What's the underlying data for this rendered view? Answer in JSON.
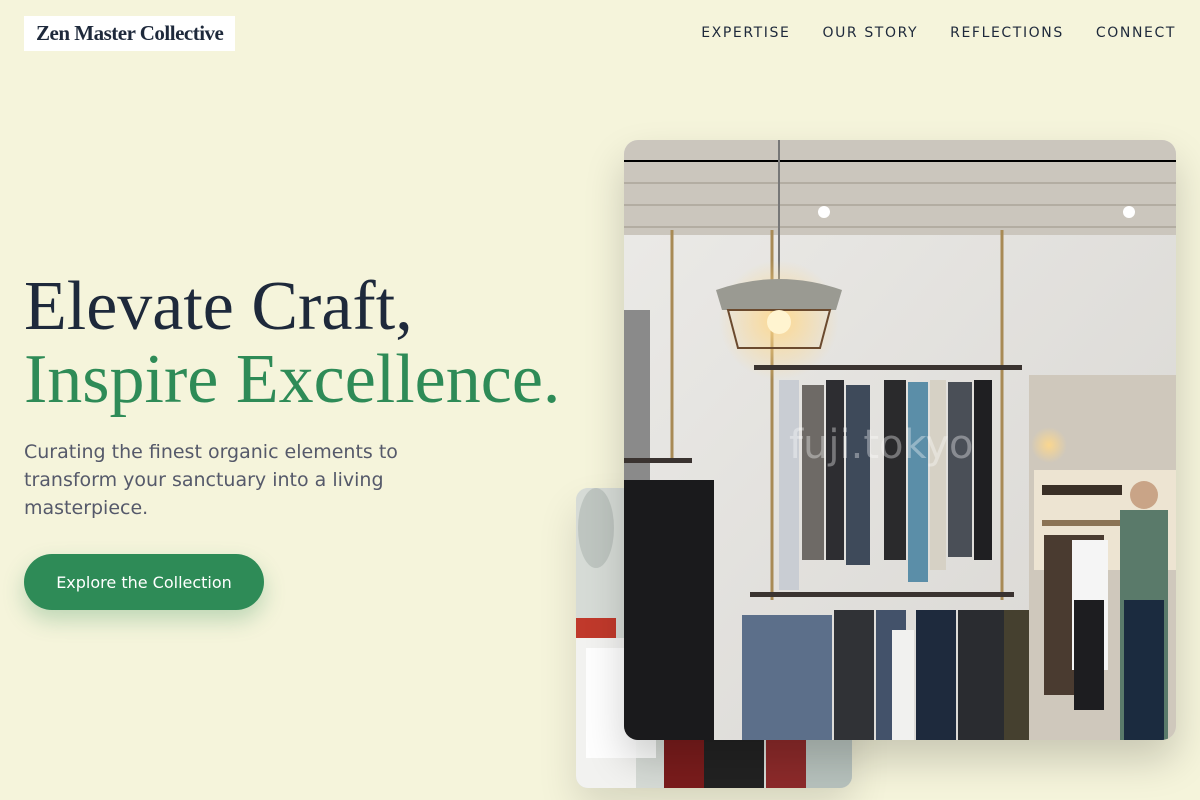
{
  "brand": {
    "logo_text": "Zen Master Collective"
  },
  "nav": {
    "items": [
      {
        "label": "EXPERTISE"
      },
      {
        "label": "OUR STORY"
      },
      {
        "label": "REFLECTIONS"
      },
      {
        "label": "CONNECT"
      }
    ]
  },
  "hero": {
    "title_line1": "Elevate Craft,",
    "title_line2": "Inspire Excellence.",
    "subtitle": "Curating the finest organic elements to transform your sanctuary into a living masterpiece.",
    "cta_label": "Explore the Collection"
  },
  "images": {
    "main_alt": "Clothing boutique interior with hanging rails and pendant lamps",
    "back_alt": "Shopping bags and garments on a rack",
    "watermark": "fuji.tokyo"
  },
  "colors": {
    "background": "#f5f4db",
    "heading": "#1e293b",
    "accent": "#2e8b57",
    "body_text": "#55596a"
  }
}
